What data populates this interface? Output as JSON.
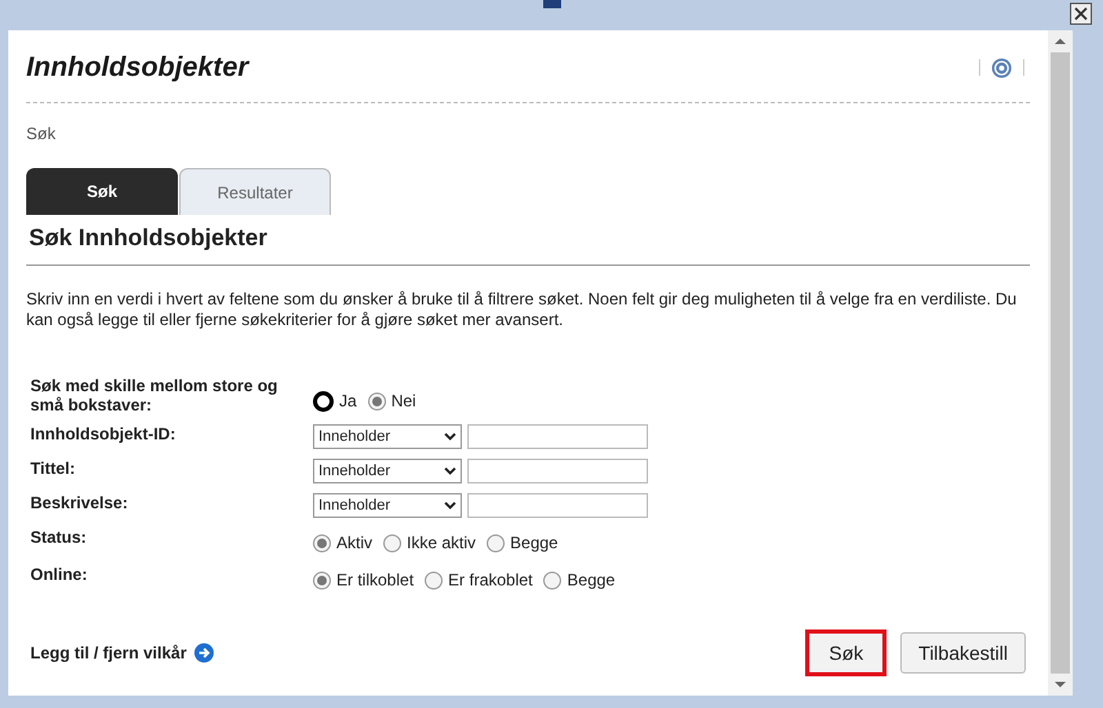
{
  "page": {
    "title": "Innholdsobjekter",
    "breadcrumb": "Søk"
  },
  "tabs": [
    {
      "label": "Søk",
      "selected": true
    },
    {
      "label": "Resultater",
      "selected": false
    }
  ],
  "section": {
    "heading": "Søk Innholdsobjekter",
    "description": "Skriv inn en verdi i hvert av feltene som du ønsker å bruke til å filtrere søket. Noen felt gir deg muligheten til å velge fra en verdiliste. Du kan også legge til eller fjerne søkekriterier for å gjøre søket mer avansert."
  },
  "fields": [
    {
      "kind": "radio",
      "label": "Søk med skille mellom store og små bokstaver:",
      "options": [
        {
          "label": "Ja",
          "selected": false,
          "focused": true
        },
        {
          "label": "Nei",
          "selected": true,
          "focused": false
        }
      ]
    },
    {
      "kind": "select",
      "label": "Innholdsobjekt-ID:",
      "operator": "Inneholder"
    },
    {
      "kind": "select",
      "label": "Tittel:",
      "operator": "Inneholder"
    },
    {
      "kind": "select",
      "label": "Beskrivelse:",
      "operator": "Inneholder"
    },
    {
      "kind": "radio",
      "label": "Status:",
      "options": [
        {
          "label": "Aktiv",
          "selected": true,
          "focused": false
        },
        {
          "label": "Ikke aktiv",
          "selected": false,
          "focused": false
        },
        {
          "label": "Begge",
          "selected": false,
          "focused": false
        }
      ]
    },
    {
      "kind": "radio",
      "label": "Online:",
      "options": [
        {
          "label": "Er tilkoblet",
          "selected": true,
          "focused": false
        },
        {
          "label": "Er frakoblet",
          "selected": false,
          "focused": false
        },
        {
          "label": "Begge",
          "selected": false,
          "focused": false
        }
      ]
    }
  ],
  "add_remove_link": "Legg til / fjern vilkår",
  "buttons": [
    {
      "label": "Søk",
      "highlighted": true
    },
    {
      "label": "Tilbakestill",
      "highlighted": false
    }
  ]
}
